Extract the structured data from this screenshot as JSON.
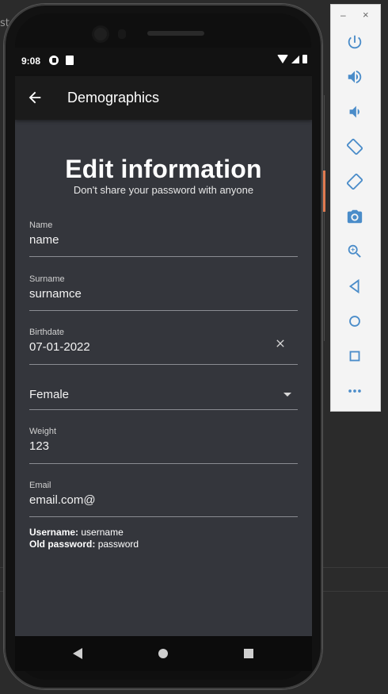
{
  "host": {
    "letters": "st"
  },
  "statusbar": {
    "time": "9:08"
  },
  "appbar": {
    "title": "Demographics"
  },
  "heading": {
    "title": "Edit information",
    "subtitle": "Don't share your password with anyone"
  },
  "fields": {
    "name": {
      "label": "Name",
      "value": "name"
    },
    "surname": {
      "label": "Surname",
      "value": "surnamce"
    },
    "birthdate": {
      "label": "Birthdate",
      "value": "07-01-2022"
    },
    "gender": {
      "value": "Female"
    },
    "weight": {
      "label": "Weight",
      "value": "123"
    },
    "email": {
      "label": "Email",
      "value": "email.com@"
    }
  },
  "info": {
    "username_label": "Username:",
    "username_value": "username",
    "oldpw_label": "Old password:",
    "oldpw_value": "password"
  },
  "panel": {
    "minimize": "–",
    "close": "×",
    "icons": [
      "power-icon",
      "volume-up-icon",
      "volume-down-icon",
      "rotate-left-icon",
      "rotate-right-icon",
      "camera-icon",
      "zoom-icon",
      "back-icon",
      "home-icon",
      "overview-icon",
      "more-icon"
    ]
  },
  "colors": {
    "screen_bg": "#34363c",
    "appbar_bg": "#1b1b1b",
    "accent_tab": "#e07a50",
    "panel_icon": "#4a8cc9"
  }
}
